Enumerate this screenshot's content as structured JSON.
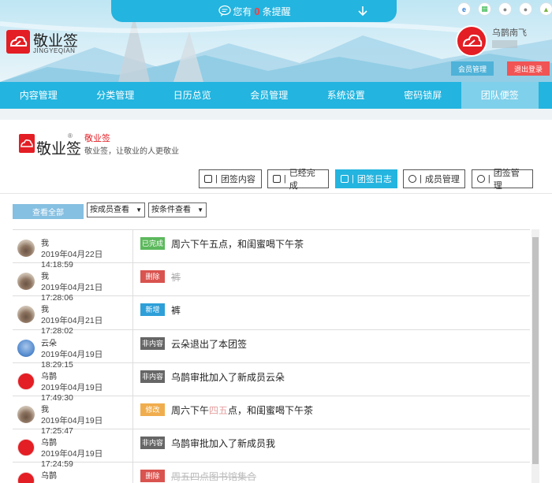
{
  "notice": {
    "prefix": "您有",
    "count": "0",
    "suffix": "条提醒"
  },
  "brand": {
    "name": "敬业签",
    "sub": "JINGYEQIAN"
  },
  "user": {
    "name": "乌鹊南飞",
    "member_button": "会员管理",
    "logout_button": "退出登录"
  },
  "nav": [
    "内容管理",
    "分类管理",
    "日历总览",
    "会员管理",
    "系统设置",
    "密码锁屏",
    "团队便签"
  ],
  "team": {
    "logo_text": "敬业签",
    "reg_mark": "®",
    "name": "敬业签",
    "desc": "敬业签，让敬业的人更敬业"
  },
  "tabs": [
    {
      "label": "团签内容",
      "icon": "grid-icon"
    },
    {
      "label": "已经完成",
      "icon": "archive-icon"
    },
    {
      "label": "团签日志",
      "icon": "log-icon"
    },
    {
      "label": "成员管理",
      "icon": "users-icon"
    },
    {
      "label": "团签管理",
      "icon": "gear-icon"
    }
  ],
  "filters": {
    "all_button": "查看全部",
    "by_member": "按成员查看",
    "by_condition": "按条件查看"
  },
  "colors": {
    "primary": "#23b4df",
    "done": "#5cb85c",
    "delete": "#d9534f",
    "add": "#2e9fd8",
    "other": "#666666",
    "edit": "#f0ad4e"
  },
  "logs": [
    {
      "name": "我",
      "time": "2019年04月22日 14:18:59",
      "badge": "已完成",
      "type": "done",
      "msg": "周六下午五点，和闺蜜喝下午茶",
      "avatar": "photo"
    },
    {
      "name": "我",
      "time": "2019年04月21日 17:28:06",
      "badge": "删除",
      "type": "delete",
      "msg": "裤",
      "avatar": "photo"
    },
    {
      "name": "我",
      "time": "2019年04月21日 17:28:02",
      "badge": "新增",
      "type": "add",
      "msg": "裤",
      "avatar": "photo"
    },
    {
      "name": "云朵",
      "time": "2019年04月19日 18:29:15",
      "badge": "非内容",
      "type": "other",
      "msg": "云朵退出了本团签",
      "avatar": "cloud"
    },
    {
      "name": "乌鹊",
      "time": "2019年04月19日 17:49:30",
      "badge": "非内容",
      "type": "other",
      "msg": "乌鹊审批加入了新成员云朵",
      "avatar": "red"
    },
    {
      "name": "我",
      "time": "2019年04月19日 17:25:47",
      "badge": "修改",
      "type": "edit",
      "msg_parts": [
        "周六下午",
        "四五",
        "点，和闺蜜喝下午茶"
      ],
      "avatar": "photo"
    },
    {
      "name": "乌鹊",
      "time": "2019年04月19日 17:24:59",
      "badge": "非内容",
      "type": "other",
      "msg": "乌鹊审批加入了新成员我",
      "avatar": "red"
    },
    {
      "name": "乌鹊",
      "time": "",
      "badge": "删除",
      "type": "delete",
      "msg": "周五四点图书馆集合",
      "avatar": "red"
    }
  ]
}
